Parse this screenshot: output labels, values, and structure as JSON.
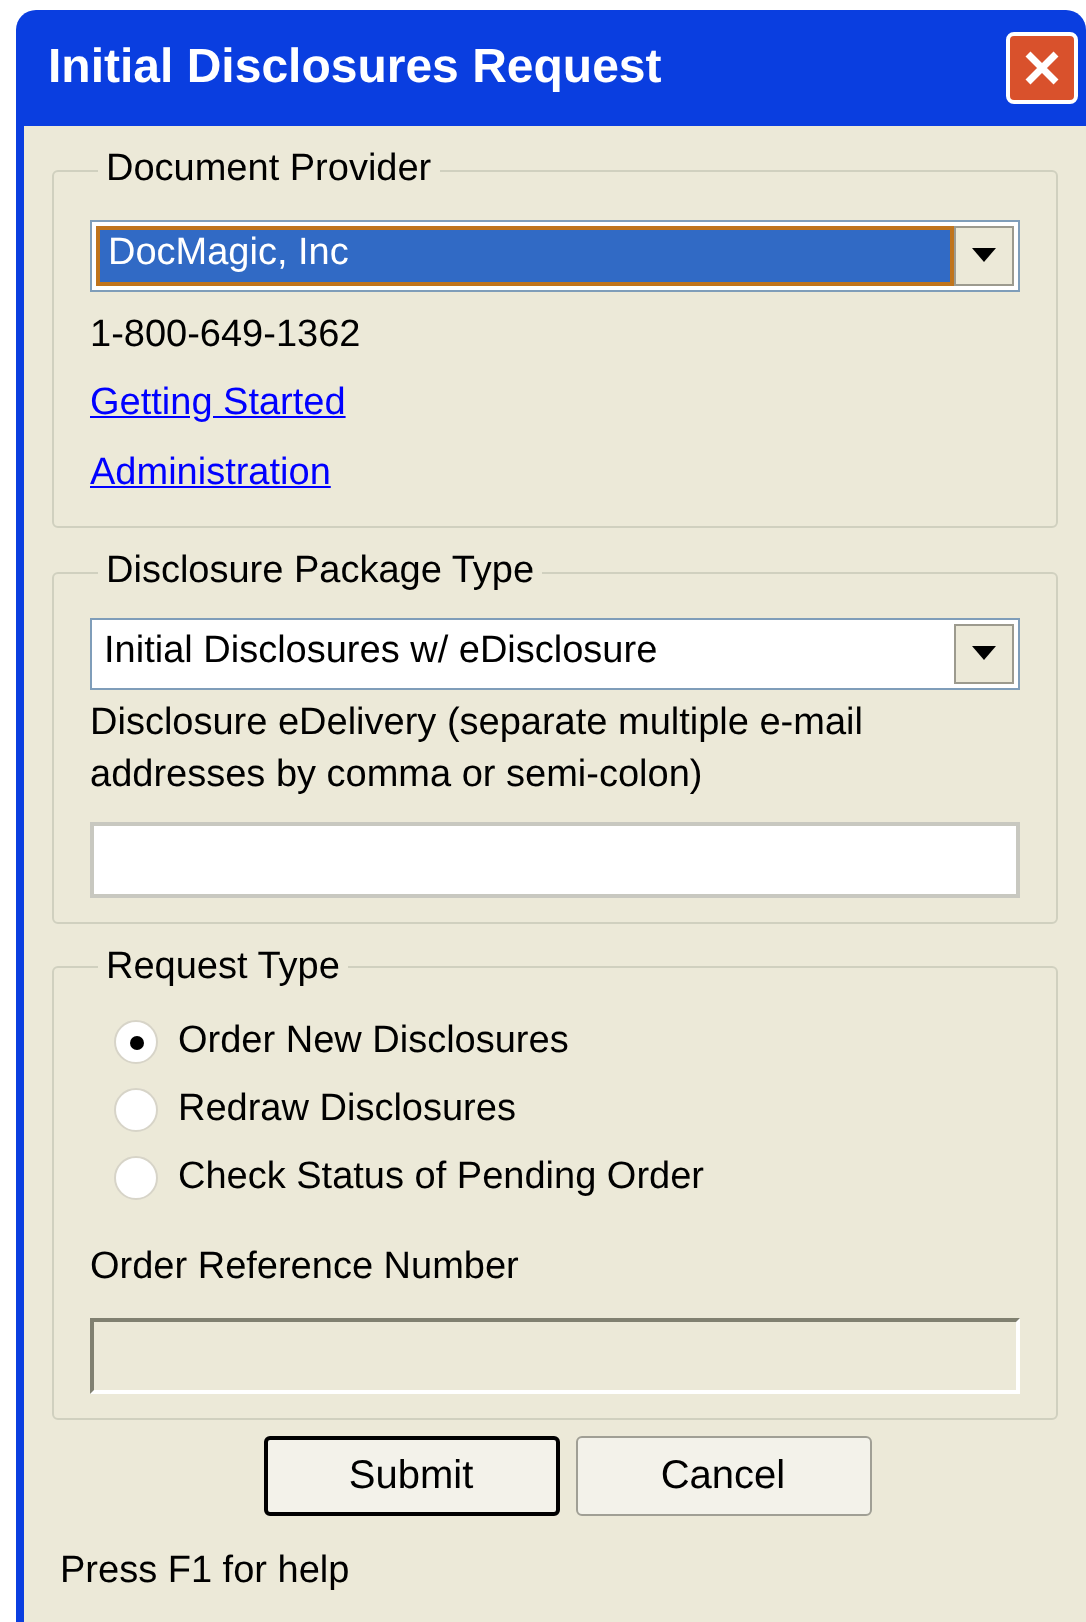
{
  "window": {
    "title": "Initial Disclosures Request"
  },
  "document_provider": {
    "legend": "Document Provider",
    "dropdown": {
      "value": "DocMagic, Inc",
      "focused": true
    },
    "phone": "1-800-649-1362",
    "links": [
      "Getting Started",
      "Administration"
    ]
  },
  "package_type": {
    "legend": "Disclosure Package Type",
    "dropdown": {
      "value": "Initial Disclosures w/ eDisclosure",
      "focused": false
    },
    "email_label": "Disclosure eDelivery (separate multiple e-mail addresses by comma or semi-colon)",
    "email_field": {
      "disabled": false
    }
  },
  "request_type": {
    "legend": "Request Type",
    "options": [
      {
        "label": "Order New Disclosures",
        "selected": true
      },
      {
        "label": "Redraw Disclosures",
        "selected": false
      },
      {
        "label": "Check Status of Pending Order",
        "selected": false
      }
    ],
    "reference_label": "Order Reference Number",
    "reference_field": {
      "disabled": true
    }
  },
  "buttons": [
    {
      "label": "Submit",
      "default": true
    },
    {
      "label": "Cancel",
      "default": false
    }
  ],
  "status_bar": "Press F1 for help"
}
